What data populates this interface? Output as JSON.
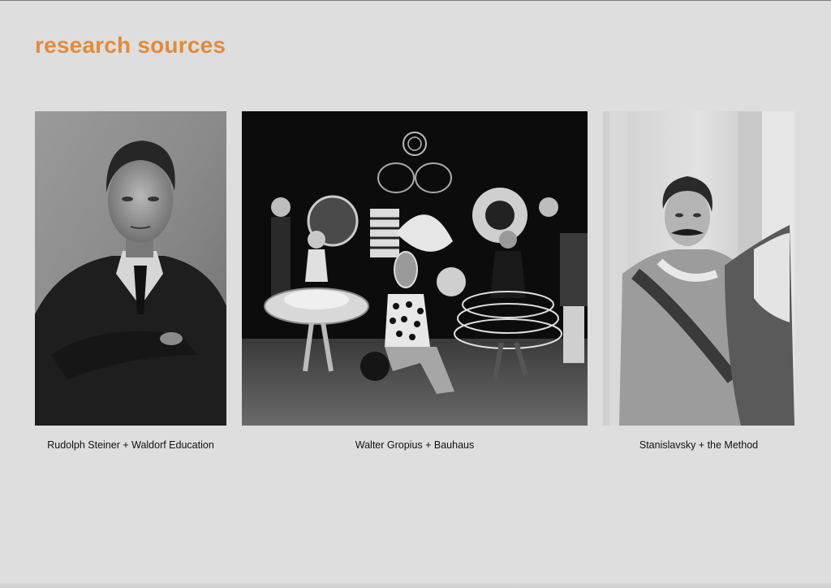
{
  "slide": {
    "title": "research sources",
    "accent_color": "#e38b3a",
    "background_color": "#dedede"
  },
  "sources": [
    {
      "caption": "Rudolph Steiner + Waldorf Education",
      "image_subject": "black-and-white portrait photograph"
    },
    {
      "caption": "Walter Gropius + Bauhaus",
      "image_subject": "black-and-white photograph of costumed dancers on stage"
    },
    {
      "caption": "Stanislavsky + the Method",
      "image_subject": "black-and-white photograph of an actor in period costume"
    }
  ]
}
